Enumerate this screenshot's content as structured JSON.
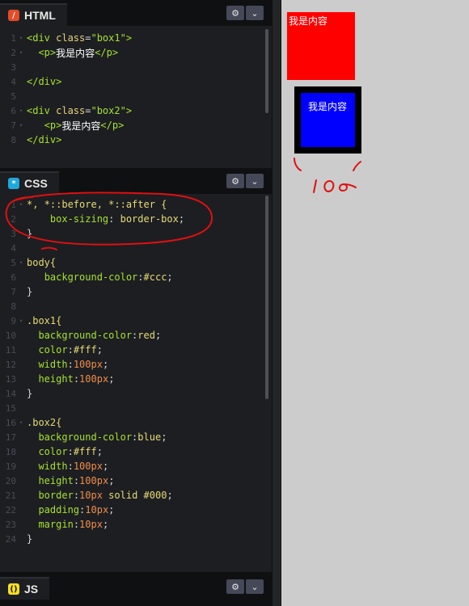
{
  "panels": {
    "html": {
      "label": "HTML",
      "icon": "html-icon"
    },
    "css": {
      "label": "CSS",
      "icon": "css-icon"
    },
    "js": {
      "label": "JS",
      "icon": "js-icon"
    }
  },
  "controls": {
    "settings_icon": "gear-icon",
    "collapse_icon": "chevron-down-icon"
  },
  "html_code": {
    "line_numbers": [
      "1",
      "2",
      "3",
      "4",
      "5",
      "6",
      "7",
      "8"
    ],
    "l1": {
      "open": "<div ",
      "attr": "class",
      "eq": "=",
      "val": "\"box1\"",
      "close": ">"
    },
    "l2": {
      "open": "<p>",
      "text": "我是内容",
      "close": "</p>"
    },
    "l4": {
      "tag": "</div>"
    },
    "l6": {
      "open": "<div ",
      "attr": "class",
      "eq": "=",
      "val": "\"box2\"",
      "close": ">"
    },
    "l7": {
      "open": "<p>",
      "text": "我是内容",
      "close": "</p>"
    },
    "l8": {
      "tag": "</div>"
    }
  },
  "css_code": {
    "line_numbers": [
      "1",
      "2",
      "3",
      "4",
      "5",
      "6",
      "7",
      "8",
      "9",
      "10",
      "11",
      "12",
      "13",
      "14",
      "15",
      "16",
      "17",
      "18",
      "19",
      "20",
      "21",
      "22",
      "23",
      "24"
    ],
    "l1": "*, *::before, *::after {",
    "l2": {
      "prop": "box-sizing",
      "val": "border-box"
    },
    "l3": "}",
    "l5": "body{",
    "l6": {
      "prop": "background-color",
      "val": "#ccc"
    },
    "l7": "}",
    "l9": ".box1{",
    "l10": {
      "prop": "background-color",
      "val": "red"
    },
    "l11": {
      "prop": "color",
      "val": "#fff"
    },
    "l12": {
      "prop": "width",
      "num": "100",
      "unit": "px"
    },
    "l13": {
      "prop": "height",
      "num": "100",
      "unit": "px"
    },
    "l14": "}",
    "l16": ".box2{",
    "l17": {
      "prop": "background-color",
      "val": "blue"
    },
    "l18": {
      "prop": "color",
      "val": "#fff"
    },
    "l19": {
      "prop": "width",
      "num": "100",
      "unit": "px"
    },
    "l20": {
      "prop": "height",
      "num": "100",
      "unit": "px"
    },
    "l21": {
      "prop": "border",
      "num": "10",
      "unit": "px",
      "rest": " solid #000"
    },
    "l22": {
      "prop": "padding",
      "num": "10",
      "unit": "px"
    },
    "l23": {
      "prop": "margin",
      "num": "10",
      "unit": "px"
    },
    "l24": "}"
  },
  "preview": {
    "box1_text": "我是内容",
    "box2_text": "我是内容"
  },
  "annotation": {
    "handwritten": "100",
    "color": "#e01010"
  },
  "colors": {
    "box1": "#ff0000",
    "box2": "#0000ff",
    "border": "#000000",
    "page_bg": "#cccccc"
  }
}
